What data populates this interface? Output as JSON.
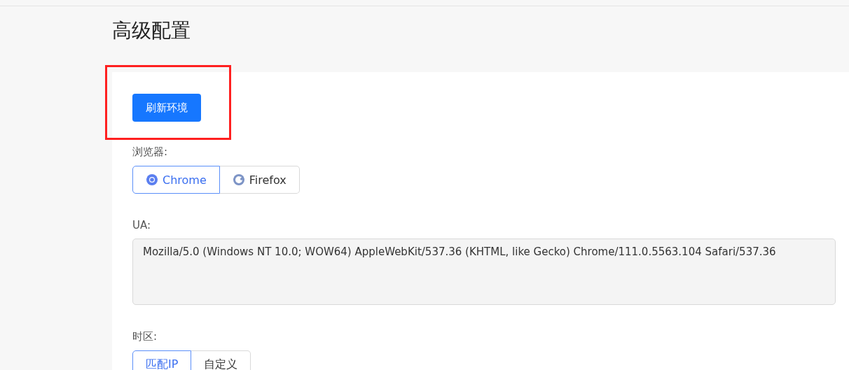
{
  "title": "高级配置",
  "refresh_button": "刷新环境",
  "browser": {
    "label": "浏览器:",
    "options": [
      {
        "label": "Chrome",
        "kind": "chrome",
        "selected": true
      },
      {
        "label": "Firefox",
        "kind": "firefox",
        "selected": false
      }
    ]
  },
  "ua": {
    "label": "UA:",
    "value": "Mozilla/5.0 (Windows NT 10.0; WOW64) AppleWebKit/537.36 (KHTML, like Gecko) Chrome/111.0.5563.104 Safari/537.36"
  },
  "timezone": {
    "label": "时区:",
    "options": [
      {
        "label": "匹配IP",
        "selected": true
      },
      {
        "label": "自定义",
        "selected": false
      }
    ]
  }
}
